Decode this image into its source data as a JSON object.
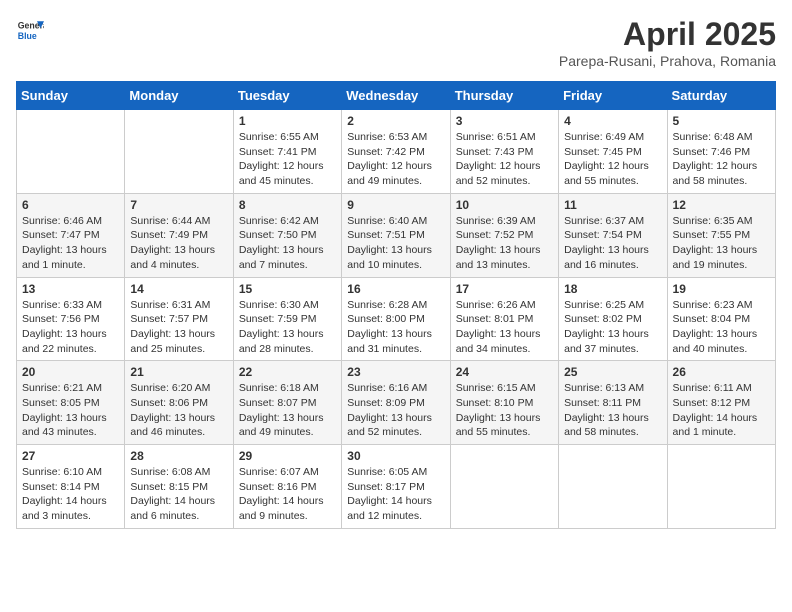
{
  "header": {
    "logo_general": "General",
    "logo_blue": "Blue",
    "month_title": "April 2025",
    "subtitle": "Parepa-Rusani, Prahova, Romania"
  },
  "weekdays": [
    "Sunday",
    "Monday",
    "Tuesday",
    "Wednesday",
    "Thursday",
    "Friday",
    "Saturday"
  ],
  "weeks": [
    [
      {
        "day": "",
        "lines": []
      },
      {
        "day": "",
        "lines": []
      },
      {
        "day": "1",
        "lines": [
          "Sunrise: 6:55 AM",
          "Sunset: 7:41 PM",
          "Daylight: 12 hours",
          "and 45 minutes."
        ]
      },
      {
        "day": "2",
        "lines": [
          "Sunrise: 6:53 AM",
          "Sunset: 7:42 PM",
          "Daylight: 12 hours",
          "and 49 minutes."
        ]
      },
      {
        "day": "3",
        "lines": [
          "Sunrise: 6:51 AM",
          "Sunset: 7:43 PM",
          "Daylight: 12 hours",
          "and 52 minutes."
        ]
      },
      {
        "day": "4",
        "lines": [
          "Sunrise: 6:49 AM",
          "Sunset: 7:45 PM",
          "Daylight: 12 hours",
          "and 55 minutes."
        ]
      },
      {
        "day": "5",
        "lines": [
          "Sunrise: 6:48 AM",
          "Sunset: 7:46 PM",
          "Daylight: 12 hours",
          "and 58 minutes."
        ]
      }
    ],
    [
      {
        "day": "6",
        "lines": [
          "Sunrise: 6:46 AM",
          "Sunset: 7:47 PM",
          "Daylight: 13 hours",
          "and 1 minute."
        ]
      },
      {
        "day": "7",
        "lines": [
          "Sunrise: 6:44 AM",
          "Sunset: 7:49 PM",
          "Daylight: 13 hours",
          "and 4 minutes."
        ]
      },
      {
        "day": "8",
        "lines": [
          "Sunrise: 6:42 AM",
          "Sunset: 7:50 PM",
          "Daylight: 13 hours",
          "and 7 minutes."
        ]
      },
      {
        "day": "9",
        "lines": [
          "Sunrise: 6:40 AM",
          "Sunset: 7:51 PM",
          "Daylight: 13 hours",
          "and 10 minutes."
        ]
      },
      {
        "day": "10",
        "lines": [
          "Sunrise: 6:39 AM",
          "Sunset: 7:52 PM",
          "Daylight: 13 hours",
          "and 13 minutes."
        ]
      },
      {
        "day": "11",
        "lines": [
          "Sunrise: 6:37 AM",
          "Sunset: 7:54 PM",
          "Daylight: 13 hours",
          "and 16 minutes."
        ]
      },
      {
        "day": "12",
        "lines": [
          "Sunrise: 6:35 AM",
          "Sunset: 7:55 PM",
          "Daylight: 13 hours",
          "and 19 minutes."
        ]
      }
    ],
    [
      {
        "day": "13",
        "lines": [
          "Sunrise: 6:33 AM",
          "Sunset: 7:56 PM",
          "Daylight: 13 hours",
          "and 22 minutes."
        ]
      },
      {
        "day": "14",
        "lines": [
          "Sunrise: 6:31 AM",
          "Sunset: 7:57 PM",
          "Daylight: 13 hours",
          "and 25 minutes."
        ]
      },
      {
        "day": "15",
        "lines": [
          "Sunrise: 6:30 AM",
          "Sunset: 7:59 PM",
          "Daylight: 13 hours",
          "and 28 minutes."
        ]
      },
      {
        "day": "16",
        "lines": [
          "Sunrise: 6:28 AM",
          "Sunset: 8:00 PM",
          "Daylight: 13 hours",
          "and 31 minutes."
        ]
      },
      {
        "day": "17",
        "lines": [
          "Sunrise: 6:26 AM",
          "Sunset: 8:01 PM",
          "Daylight: 13 hours",
          "and 34 minutes."
        ]
      },
      {
        "day": "18",
        "lines": [
          "Sunrise: 6:25 AM",
          "Sunset: 8:02 PM",
          "Daylight: 13 hours",
          "and 37 minutes."
        ]
      },
      {
        "day": "19",
        "lines": [
          "Sunrise: 6:23 AM",
          "Sunset: 8:04 PM",
          "Daylight: 13 hours",
          "and 40 minutes."
        ]
      }
    ],
    [
      {
        "day": "20",
        "lines": [
          "Sunrise: 6:21 AM",
          "Sunset: 8:05 PM",
          "Daylight: 13 hours",
          "and 43 minutes."
        ]
      },
      {
        "day": "21",
        "lines": [
          "Sunrise: 6:20 AM",
          "Sunset: 8:06 PM",
          "Daylight: 13 hours",
          "and 46 minutes."
        ]
      },
      {
        "day": "22",
        "lines": [
          "Sunrise: 6:18 AM",
          "Sunset: 8:07 PM",
          "Daylight: 13 hours",
          "and 49 minutes."
        ]
      },
      {
        "day": "23",
        "lines": [
          "Sunrise: 6:16 AM",
          "Sunset: 8:09 PM",
          "Daylight: 13 hours",
          "and 52 minutes."
        ]
      },
      {
        "day": "24",
        "lines": [
          "Sunrise: 6:15 AM",
          "Sunset: 8:10 PM",
          "Daylight: 13 hours",
          "and 55 minutes."
        ]
      },
      {
        "day": "25",
        "lines": [
          "Sunrise: 6:13 AM",
          "Sunset: 8:11 PM",
          "Daylight: 13 hours",
          "and 58 minutes."
        ]
      },
      {
        "day": "26",
        "lines": [
          "Sunrise: 6:11 AM",
          "Sunset: 8:12 PM",
          "Daylight: 14 hours",
          "and 1 minute."
        ]
      }
    ],
    [
      {
        "day": "27",
        "lines": [
          "Sunrise: 6:10 AM",
          "Sunset: 8:14 PM",
          "Daylight: 14 hours",
          "and 3 minutes."
        ]
      },
      {
        "day": "28",
        "lines": [
          "Sunrise: 6:08 AM",
          "Sunset: 8:15 PM",
          "Daylight: 14 hours",
          "and 6 minutes."
        ]
      },
      {
        "day": "29",
        "lines": [
          "Sunrise: 6:07 AM",
          "Sunset: 8:16 PM",
          "Daylight: 14 hours",
          "and 9 minutes."
        ]
      },
      {
        "day": "30",
        "lines": [
          "Sunrise: 6:05 AM",
          "Sunset: 8:17 PM",
          "Daylight: 14 hours",
          "and 12 minutes."
        ]
      },
      {
        "day": "",
        "lines": []
      },
      {
        "day": "",
        "lines": []
      },
      {
        "day": "",
        "lines": []
      }
    ]
  ]
}
